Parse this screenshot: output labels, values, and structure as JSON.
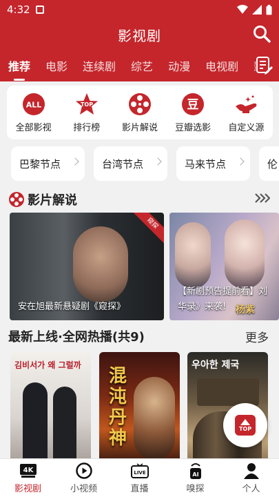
{
  "status_bar": {
    "time": "4:32"
  },
  "header": {
    "title": "影视剧"
  },
  "tabs": [
    {
      "label": "推荐",
      "active": true
    },
    {
      "label": "电影",
      "active": false
    },
    {
      "label": "连续剧",
      "active": false
    },
    {
      "label": "综艺",
      "active": false
    },
    {
      "label": "动漫",
      "active": false
    },
    {
      "label": "电视剧",
      "active": false
    },
    {
      "label": "影",
      "active": false
    }
  ],
  "categories": [
    {
      "label": "全部影视",
      "icon": "all-icon",
      "icon_text": "ALL"
    },
    {
      "label": "排行榜",
      "icon": "top-star-icon",
      "icon_text": "TOP"
    },
    {
      "label": "影片解说",
      "icon": "film-reel-icon"
    },
    {
      "label": "豆瓣选影",
      "icon": "douban-icon",
      "icon_text": "豆"
    },
    {
      "label": "自定义源",
      "icon": "magic-lamp-icon"
    }
  ],
  "nodes": [
    "巴黎节点",
    "台湾节点",
    "马来节点",
    "伦"
  ],
  "section_commentary": {
    "title": "影片解说"
  },
  "banners": [
    {
      "caption": "安在旭最新悬疑剧《窥探》",
      "badge": "窥探"
    },
    {
      "caption": "【新剧预告提前看】刘",
      "caption2": "华录》来袭!",
      "watermark": "杨紫"
    }
  ],
  "section_latest": {
    "title": "最新上线·全网热播(共9)",
    "more": "更多"
  },
  "posters": [
    {
      "title": "김비서가 왜 그럴까"
    },
    {
      "title": "混沌丹神"
    },
    {
      "title": "우아한 제국"
    }
  ],
  "fab": {
    "label": "TOP"
  },
  "bottom_nav": [
    {
      "label": "影视剧",
      "icon": "4k-icon",
      "icon_text": "4K",
      "active": true
    },
    {
      "label": "小视频",
      "icon": "play-circle-icon",
      "active": false
    },
    {
      "label": "直播",
      "icon": "live-tv-icon",
      "icon_text": "LIVE",
      "active": false
    },
    {
      "label": "嗅探",
      "icon": "ai-sniff-icon",
      "icon_text": "AI",
      "active": false
    },
    {
      "label": "个人",
      "icon": "person-icon",
      "active": false
    }
  ],
  "colors": {
    "brand": "#c4262c",
    "background": "#f1f1f1"
  }
}
